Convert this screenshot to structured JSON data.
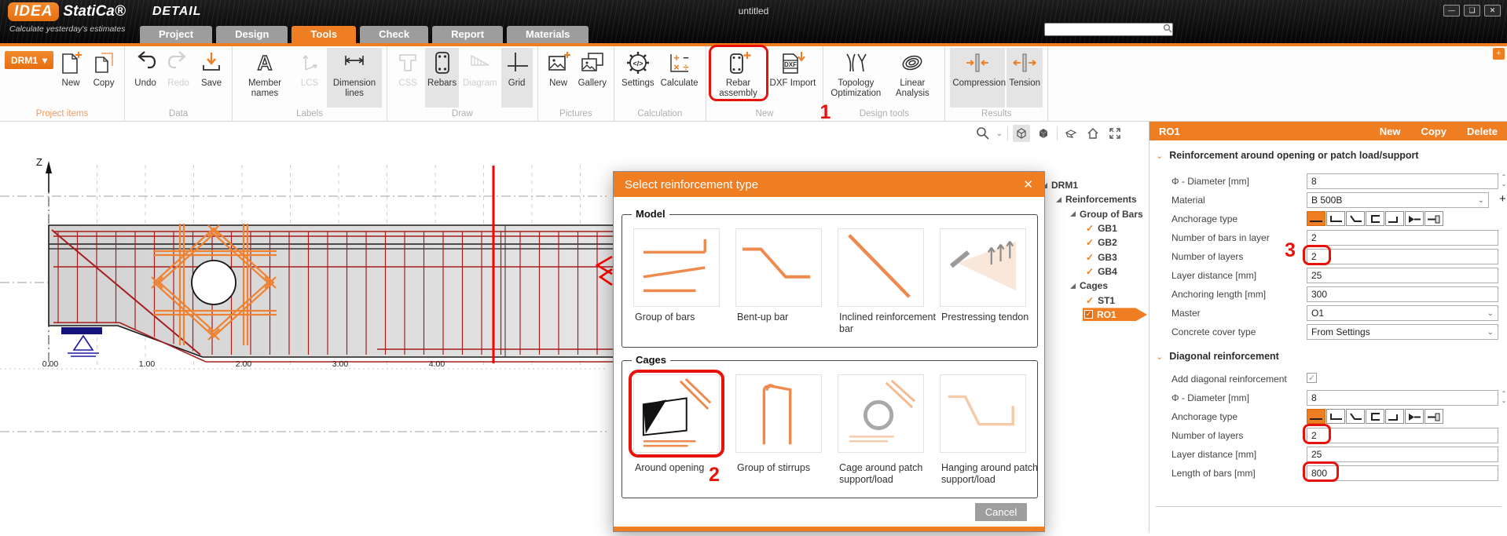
{
  "titlebar": {
    "logo_idea": "IDEA",
    "logo_statica": "StatiCa®",
    "product": "DETAIL",
    "tagline": "Calculate yesterday's estimates",
    "window_title": "untitled"
  },
  "icons": {
    "check": "✓",
    "close": "✕",
    "caret_down": "▾",
    "chevron_down": "⌄",
    "chevron_up": "⌃",
    "minimize": "—",
    "restore": "❏",
    "window_close": "✕",
    "plus": "+",
    "minus": "−",
    "times": "×",
    "divide": "÷",
    "dxf": "DXF",
    "code": "</>",
    "letter_a": "A",
    "corner_plus": "+"
  },
  "search": {
    "value": ""
  },
  "tabs": [
    {
      "label": "Project"
    },
    {
      "label": "Design"
    },
    {
      "label": "Tools"
    },
    {
      "label": "Check"
    },
    {
      "label": "Report"
    },
    {
      "label": "Materials"
    }
  ],
  "ribbon": {
    "groups": [
      {
        "label": "Project items",
        "items": [
          {
            "label": "DRM1"
          },
          {
            "label": "New"
          },
          {
            "label": "Copy"
          }
        ]
      },
      {
        "label": "Data",
        "items": [
          {
            "label": "Undo"
          },
          {
            "label": "Redo"
          },
          {
            "label": "Save"
          }
        ]
      },
      {
        "label": "Labels",
        "items": [
          {
            "label": "Member names"
          },
          {
            "label": "LCS"
          },
          {
            "label": "Dimension lines"
          }
        ]
      },
      {
        "label": "Draw",
        "items": [
          {
            "label": "CSS"
          },
          {
            "label": "Rebars"
          },
          {
            "label": "Diagram"
          },
          {
            "label": "Grid"
          }
        ]
      },
      {
        "label": "Pictures",
        "items": [
          {
            "label": "New"
          },
          {
            "label": "Gallery"
          }
        ]
      },
      {
        "label": "Calculation",
        "items": [
          {
            "label": "Settings"
          },
          {
            "label": "Calculate"
          }
        ]
      },
      {
        "label": "New",
        "items": [
          {
            "label": "Rebar assembly"
          },
          {
            "label": "DXF Import"
          }
        ]
      },
      {
        "label": "Design tools",
        "items": [
          {
            "label": "Topology Optimization"
          },
          {
            "label": "Linear Analysis"
          }
        ]
      },
      {
        "label": "Results",
        "items": [
          {
            "label": "Compression"
          },
          {
            "label": "Tension"
          }
        ]
      }
    ]
  },
  "annotations": {
    "step1": "1",
    "step2": "2",
    "step3": "3"
  },
  "canvas": {
    "axis_z": "Z",
    "ticks": [
      "0.00",
      "1.00",
      "2.00",
      "3.00",
      "4.00"
    ]
  },
  "tree": {
    "items": [
      {
        "label": "DRM1"
      },
      {
        "label": "Reinforcements"
      },
      {
        "label": "Group of Bars"
      },
      {
        "label": "GB1"
      },
      {
        "label": "GB2"
      },
      {
        "label": "GB3"
      },
      {
        "label": "GB4"
      },
      {
        "label": "Cages"
      },
      {
        "label": "ST1"
      },
      {
        "label": "RO1"
      }
    ]
  },
  "dialog": {
    "title": "Select reinforcement type",
    "model": {
      "label": "Model",
      "items": [
        {
          "label": "Group of bars"
        },
        {
          "label": "Bent-up bar"
        },
        {
          "label": "Inclined reinforcement bar"
        },
        {
          "label": "Prestressing tendon"
        }
      ]
    },
    "cages": {
      "label": "Cages",
      "items": [
        {
          "label": "Around opening"
        },
        {
          "label": "Group of stirrups"
        },
        {
          "label": "Cage around patch support/load"
        },
        {
          "label": "Hanging around patch support/load"
        }
      ]
    },
    "cancel_label": "Cancel"
  },
  "properties": {
    "header": {
      "title": "RO1",
      "new_label": "New",
      "copy_label": "Copy",
      "delete_label": "Delete"
    },
    "opening_section": {
      "title": "Reinforcement around opening or patch load/support",
      "diameter": {
        "label": "Φ - Diameter [mm]",
        "value": "8"
      },
      "material": {
        "label": "Material",
        "value": "B 500B"
      },
      "anchorage": {
        "label": "Anchorage type"
      },
      "bars_in_layer": {
        "label": "Number of bars in layer",
        "value": "2"
      },
      "layers": {
        "label": "Number of layers",
        "value": "2"
      },
      "layer_distance": {
        "label": "Layer distance [mm]",
        "value": "25"
      },
      "anchoring_length": {
        "label": "Anchoring length [mm]",
        "value": "300"
      },
      "master": {
        "label": "Master",
        "value": "O1"
      },
      "cover": {
        "label": "Concrete cover type",
        "value": "From Settings"
      }
    },
    "diagonal_section": {
      "title": "Diagonal reinforcement",
      "add": {
        "label": "Add diagonal reinforcement"
      },
      "diameter": {
        "label": "Φ - Diameter [mm]",
        "value": "8"
      },
      "anchorage": {
        "label": "Anchorage type"
      },
      "layers": {
        "label": "Number of layers",
        "value": "2"
      },
      "layer_distance": {
        "label": "Layer distance [mm]",
        "value": "25"
      },
      "bar_length": {
        "label": "Length of bars [mm]",
        "value": "800"
      }
    }
  }
}
